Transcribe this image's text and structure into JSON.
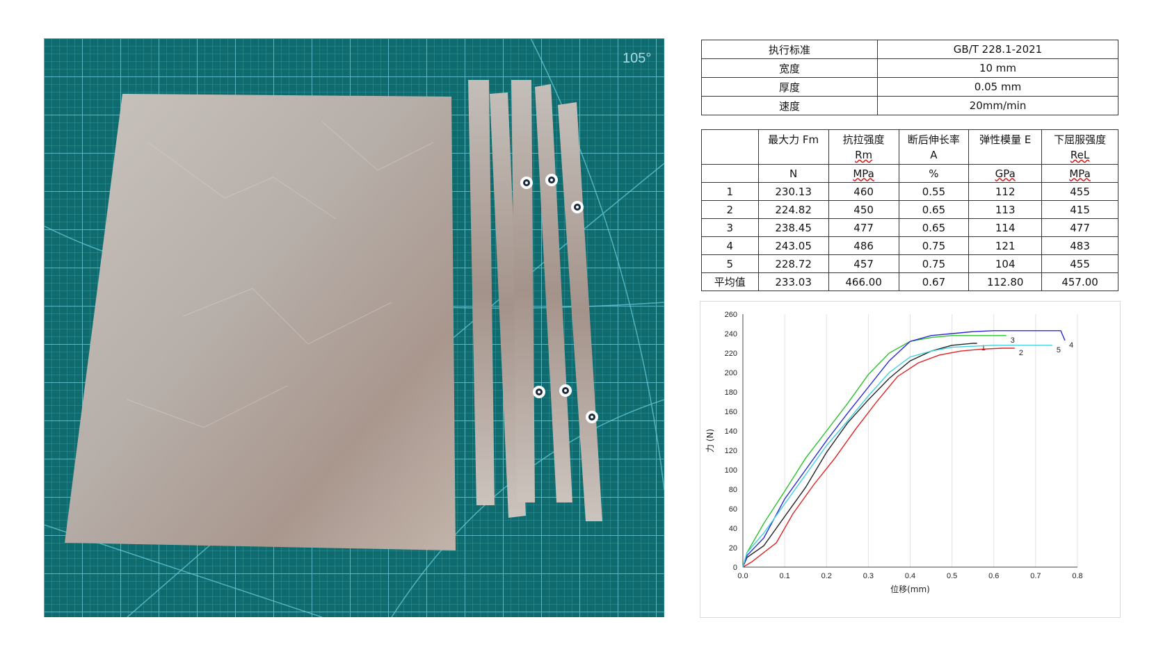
{
  "photo": {
    "angle_label": "105°",
    "colors": {
      "mat": "#0f6b6d",
      "grid": "#5fc1d2",
      "foil": "#b8b0aa"
    }
  },
  "standard_table": {
    "rows": [
      {
        "label": "执行标准",
        "value": "GB/T 228.1-2021"
      },
      {
        "label": "宽度",
        "value": "10 mm"
      },
      {
        "label": "厚度",
        "value": "0.05 mm"
      },
      {
        "label": "速度",
        "value": "20mm/min"
      }
    ]
  },
  "results_table": {
    "headers": [
      "",
      "最大力  Fm",
      "抗拉强度\nRm",
      "断后伸长率\nA",
      "弹性模量 E",
      "下屈服强度\nReL"
    ],
    "units": [
      "",
      "N",
      "MPa",
      "%",
      "GPa",
      "MPa"
    ],
    "rows": [
      [
        "1",
        "230.13",
        "460",
        "0.55",
        "112",
        "455"
      ],
      [
        "2",
        "224.82",
        "450",
        "0.65",
        "113",
        "415"
      ],
      [
        "3",
        "238.45",
        "477",
        "0.65",
        "114",
        "477"
      ],
      [
        "4",
        "243.05",
        "486",
        "0.75",
        "121",
        "483"
      ],
      [
        "5",
        "228.72",
        "457",
        "0.75",
        "104",
        "455"
      ],
      [
        "平均值",
        "233.03",
        "466.00",
        "0.67",
        "112.80",
        "457.00"
      ]
    ]
  },
  "chart_data": {
    "type": "line",
    "xlabel": "位移(mm)",
    "ylabel": "力 (N)",
    "xlim": [
      0,
      0.8
    ],
    "ylim": [
      0,
      260
    ],
    "x_ticks": [
      "0.0",
      "0.1",
      "0.2",
      "0.3",
      "0.4",
      "0.5",
      "0.6",
      "0.7",
      "0.8"
    ],
    "y_ticks": [
      "0",
      "20",
      "40",
      "60",
      "80",
      "100",
      "120",
      "140",
      "160",
      "180",
      "200",
      "220",
      "240",
      "260"
    ],
    "grid": "vertical",
    "series": [
      {
        "name": "1",
        "color": "#222222",
        "x": [
          0,
          0.01,
          0.05,
          0.1,
          0.15,
          0.2,
          0.25,
          0.3,
          0.35,
          0.4,
          0.45,
          0.5,
          0.55,
          0.56
        ],
        "y": [
          0,
          10,
          22,
          52,
          82,
          118,
          148,
          172,
          194,
          212,
          222,
          228,
          230,
          230
        ]
      },
      {
        "name": "2",
        "color": "#e02020",
        "x": [
          0,
          0.02,
          0.08,
          0.12,
          0.17,
          0.22,
          0.27,
          0.32,
          0.37,
          0.42,
          0.47,
          0.52,
          0.57,
          0.62,
          0.65
        ],
        "y": [
          0,
          5,
          25,
          55,
          85,
          112,
          142,
          170,
          196,
          210,
          218,
          222,
          224,
          225,
          225
        ]
      },
      {
        "name": "3",
        "color": "#2cc02c",
        "x": [
          0,
          0.01,
          0.05,
          0.1,
          0.15,
          0.2,
          0.25,
          0.3,
          0.35,
          0.4,
          0.45,
          0.5,
          0.55,
          0.6,
          0.63
        ],
        "y": [
          0,
          15,
          45,
          78,
          112,
          140,
          168,
          198,
          220,
          232,
          236,
          238,
          238,
          238,
          238
        ]
      },
      {
        "name": "4",
        "color": "#2828d8",
        "x": [
          0,
          0.01,
          0.05,
          0.1,
          0.15,
          0.2,
          0.25,
          0.3,
          0.35,
          0.4,
          0.45,
          0.5,
          0.55,
          0.6,
          0.65,
          0.7,
          0.76,
          0.77
        ],
        "y": [
          0,
          12,
          30,
          70,
          100,
          130,
          158,
          185,
          212,
          232,
          238,
          240,
          242,
          243,
          243,
          243,
          243,
          233
        ]
      },
      {
        "name": "5",
        "color": "#3fd0e0",
        "x": [
          0,
          0.01,
          0.05,
          0.1,
          0.15,
          0.2,
          0.25,
          0.3,
          0.35,
          0.4,
          0.45,
          0.5,
          0.55,
          0.6,
          0.65,
          0.7,
          0.74
        ],
        "y": [
          0,
          15,
          35,
          65,
          95,
          125,
          150,
          176,
          200,
          216,
          222,
          226,
          227,
          228,
          228,
          228,
          228
        ]
      }
    ]
  }
}
